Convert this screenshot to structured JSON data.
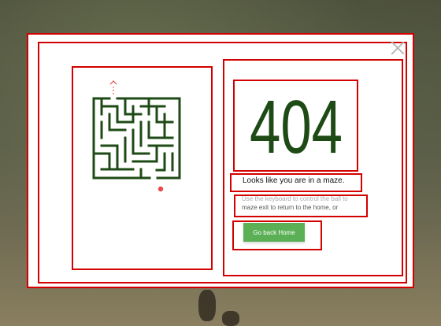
{
  "error_page": {
    "code": "404",
    "heading": "Looks like you are in a maze.",
    "description_line1": "Use the keyboard to control the ball to",
    "description_line2": "maze exit to return to the home, or",
    "home_button_label": "Go back Home"
  },
  "colors": {
    "maze_wall": "#1e4a16",
    "code_text": "#1e4a16",
    "ball": "#e84a4a",
    "exit_marker": "#e84a4a",
    "button_bg": "#5bb055",
    "annotation_box": "#d40000"
  },
  "icons": {
    "close": "close-icon",
    "exit_arrow": "up-arrow-icon"
  }
}
